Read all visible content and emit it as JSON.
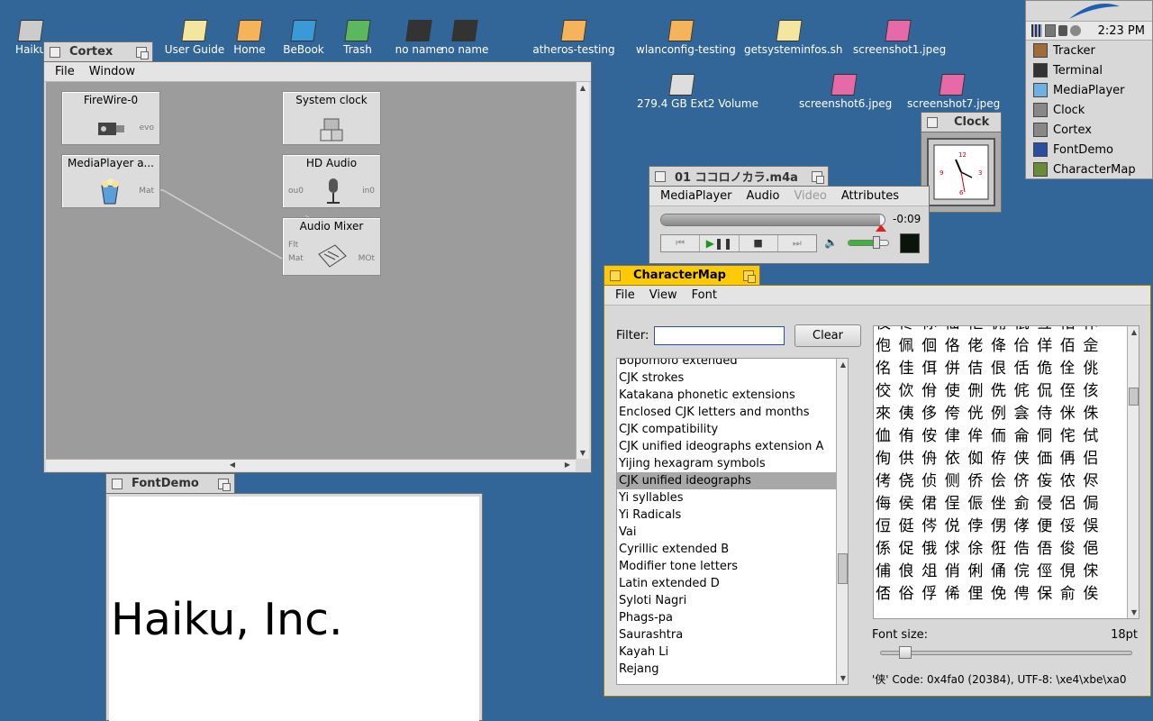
{
  "desktop": {
    "icons": [
      {
        "label": "Haiku",
        "icon": "computer-icon"
      },
      {
        "label": "User Guide",
        "icon": "document-icon"
      },
      {
        "label": "Home",
        "icon": "home-folder-icon"
      },
      {
        "label": "BeBook",
        "icon": "globe-icon"
      },
      {
        "label": "Trash",
        "icon": "trash-icon"
      },
      {
        "label": "no name",
        "icon": "usb-drive-icon"
      },
      {
        "label": "no name",
        "icon": "usb-drive-icon"
      },
      {
        "label": "atheros-testing",
        "icon": "folder-icon"
      },
      {
        "label": "wlanconfig-testing",
        "icon": "folder-icon"
      },
      {
        "label": "getsysteminfos.sh",
        "icon": "script-icon"
      },
      {
        "label": "screenshot1.jpeg",
        "icon": "image-icon"
      },
      {
        "label": "279.4 GB Ext2 Volume",
        "icon": "disk-icon"
      },
      {
        "label": "screenshot6.jpeg",
        "icon": "image-icon"
      },
      {
        "label": "screenshot7.jpeg",
        "icon": "image-icon"
      }
    ]
  },
  "deskbar": {
    "time": "2:23 PM",
    "items": [
      "Tracker",
      "Terminal",
      "MediaPlayer",
      "Clock",
      "Cortex",
      "FontDemo",
      "CharacterMap"
    ]
  },
  "cortex": {
    "title": "Cortex",
    "menu": [
      "File",
      "Window"
    ],
    "nodes": {
      "firewire": {
        "label": "FireWire-0",
        "out": "evo"
      },
      "clock": {
        "label": "System clock"
      },
      "mediaplayer": {
        "label": "MediaPlayer a...",
        "out": "Mat"
      },
      "hdaudio": {
        "label": "HD Audio",
        "in": "ou0",
        "out": "in0"
      },
      "mixer": {
        "label": "Audio Mixer",
        "in1": "Flt",
        "in2": "Mat",
        "out": "MOt"
      }
    }
  },
  "clockwin": {
    "title": "Clock"
  },
  "mediaplayer": {
    "title": "01 ココロノカラ.m4a",
    "menu": [
      "MediaPlayer",
      "Audio",
      "Video",
      "Attributes"
    ],
    "time_remaining": "-0:09",
    "progress": 0.98,
    "volume": 0.7
  },
  "fontdemo": {
    "title": "FontDemo",
    "text": "Haiku, Inc."
  },
  "charmap": {
    "title": "CharacterMap",
    "menu": [
      "File",
      "View",
      "Font"
    ],
    "filter_label": "Filter:",
    "filter_value": "",
    "clear_label": "Clear",
    "blocks": [
      "Bopomofo extended",
      "CJK strokes",
      "Katakana phonetic extensions",
      "Enclosed CJK letters and months",
      "CJK compatibility",
      "CJK unified ideographs extension A",
      "Yijing hexagram symbols",
      "CJK unified ideographs",
      "Yi syllables",
      "Yi Radicals",
      "Vai",
      "Cyrillic extended B",
      "Modifier tone letters",
      "Latin extended D",
      "Syloti Nagri",
      "Phags-pa",
      "Saurashtra",
      "Kayah Li",
      "Rejang"
    ],
    "selected_block": 7,
    "rows": [
      "佼佟你佡佢佣佤佥佦佧",
      "佨佩佪佫佬佭佮佯佰佱",
      "佲佳佴併佶佷佸佹佺佻",
      "佼佽佾使侀侁侂侃侄侅",
      "來侇侈侉侊例侌侍侎侏",
      "侐侑侒侓侔侕侖侗侘侙",
      "侚供侜依侞侟侠価侢侣",
      "侤侥侦侧侨侩侪侫侬侭",
      "侮侯侰侱侲侳侴侵侶侷",
      "侸侹侺侻侼侽侾便俀俁",
      "係促俄俅俆俇俈俉俊俋",
      "俌俍俎俏俐俑俒俓俔俕",
      "俖俗俘俙俚俛俜保俞俟"
    ],
    "font_size_label": "Font size:",
    "font_size_value": "18pt",
    "font_size_fraction": 0.1,
    "status": "'侠' Code: 0x4fa0 (20384), UTF-8: \\xe4\\xbe\\xa0"
  }
}
